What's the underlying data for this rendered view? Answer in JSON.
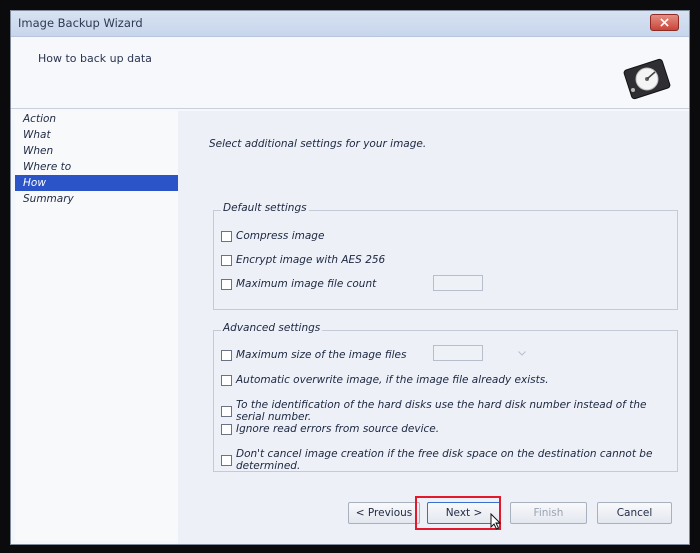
{
  "window": {
    "title": "Image Backup Wizard",
    "subtitle": "How to back up data"
  },
  "sidebar": {
    "items": [
      {
        "label": "Action",
        "active": false
      },
      {
        "label": "What",
        "active": false
      },
      {
        "label": "When",
        "active": false
      },
      {
        "label": "Where to",
        "active": false
      },
      {
        "label": "How",
        "active": true
      },
      {
        "label": "Summary",
        "active": false
      }
    ]
  },
  "main": {
    "intro": "Select additional settings for your image.",
    "default_settings": {
      "label": "Default settings",
      "options": [
        "Compress image",
        "Encrypt image with AES 256",
        "Maximum image file count"
      ]
    },
    "advanced_settings": {
      "label": "Advanced settings",
      "options": [
        "Maximum size of the image files",
        "Automatic overwrite image, if the image file already exists.",
        "To the identification of the hard disks use the hard disk number instead of the serial number.",
        "Ignore read errors from source device.",
        "Don't cancel image creation if the free disk space on the destination cannot be determined."
      ]
    }
  },
  "buttons": {
    "previous": "< Previous",
    "next": "Next >",
    "finish": "Finish",
    "cancel": "Cancel"
  },
  "icons": {
    "close": "close-icon",
    "header": "hard-disk-icon",
    "dropdown": "chevron-down-icon",
    "cursor": "mouse-pointer-icon"
  },
  "colors": {
    "active_item": "#2a54c8",
    "highlight": "#e3192b"
  }
}
